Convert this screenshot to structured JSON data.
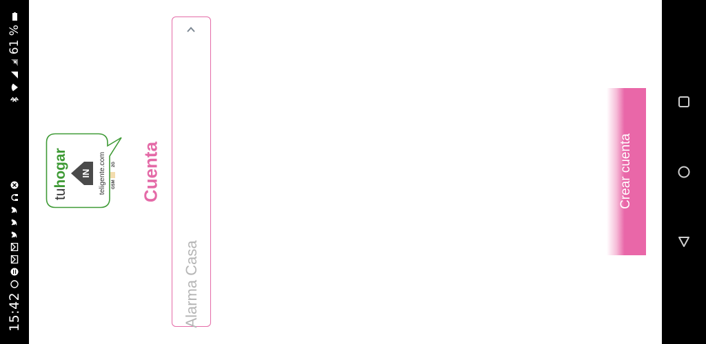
{
  "status_bar": {
    "time": "15:42",
    "battery": "61 %",
    "icons": [
      "whatsapp-icon",
      "notification-icon",
      "gmail-icon",
      "gmail-icon",
      "twitter-icon",
      "twitter-icon",
      "twitter-icon",
      "headset-icon",
      "vpn-icon",
      "bluetooth-icon",
      "wifi-icon",
      "signal-icon",
      "no-signal-icon"
    ]
  },
  "logo": {
    "brand_tu": "tu",
    "brand_hogar": "hogar",
    "brand_in": "IN",
    "url": "teligente.com",
    "gsm": "GSM",
    "g2": "2G"
  },
  "page": {
    "title": "Cuenta"
  },
  "account_select": {
    "value": "Alarma Casa"
  },
  "create_button": {
    "label": "Crear cuenta"
  },
  "colors": {
    "accent": "#e46aa7",
    "logo_green": "#3e9a35"
  }
}
